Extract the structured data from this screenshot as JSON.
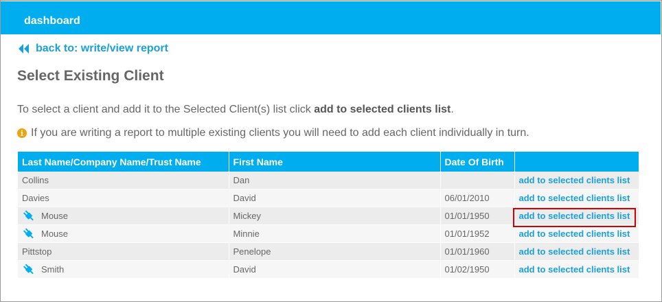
{
  "header": {
    "title": "dashboard"
  },
  "back_link": {
    "label": "back to: write/view report"
  },
  "page_title": "Select Existing Client",
  "instruction": {
    "prefix": "To select a client and add it to the Selected Client(s) list click ",
    "bold": "add to selected clients list",
    "suffix": "."
  },
  "info_note": "If you are writing a report to multiple existing clients you will need to add each client individually in turn.",
  "table": {
    "columns": [
      "Last Name/Company Name/Trust Name",
      "First Name",
      "Date Of Birth",
      ""
    ],
    "rows": [
      {
        "last_name": "Collins",
        "first_name": "Dan",
        "dob": "",
        "action": "add to selected clients list",
        "icon": false
      },
      {
        "last_name": "Davies",
        "first_name": "David",
        "dob": "06/01/2010",
        "action": "add to selected clients list",
        "icon": false
      },
      {
        "last_name": "Mouse",
        "first_name": "Mickey",
        "dob": "01/01/1950",
        "action": "add to selected clients list",
        "icon": true
      },
      {
        "last_name": "Mouse",
        "first_name": "Minnie",
        "dob": "01/01/1952",
        "action": "add to selected clients list",
        "icon": true
      },
      {
        "last_name": "Pittstop",
        "first_name": "Penelope",
        "dob": "01/01/1960",
        "action": "add to selected clients list",
        "icon": false
      },
      {
        "last_name": "Smith",
        "first_name": "David",
        "dob": "01/02/1950",
        "action": "add to selected clients list",
        "icon": true
      }
    ]
  },
  "colors": {
    "header_bg": "#00aeef",
    "link": "#1ba0d8",
    "highlight": "#d40000",
    "info_icon": "#f0a30a"
  },
  "icons": {
    "back": "double-chevron-left-icon",
    "info": "info-icon",
    "row": "plug-icon"
  }
}
